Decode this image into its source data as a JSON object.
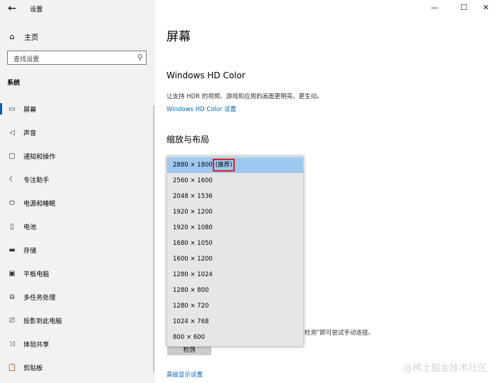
{
  "window": {
    "title": "设置",
    "back_glyph": "←",
    "controls": {
      "minimize": "—",
      "maximize": "☐",
      "close": "✕"
    }
  },
  "sidebar": {
    "home": {
      "icon": "home-icon",
      "label": "主页"
    },
    "search": {
      "placeholder": "查找设置"
    },
    "section": "系统",
    "items": [
      {
        "label": "屏幕",
        "icon": "display-icon",
        "active": true
      },
      {
        "label": "声音",
        "icon": "speaker-icon"
      },
      {
        "label": "通知和操作",
        "icon": "notification-icon"
      },
      {
        "label": "专注助手",
        "icon": "moon-icon"
      },
      {
        "label": "电源和睡眠",
        "icon": "power-icon"
      },
      {
        "label": "电池",
        "icon": "battery-icon"
      },
      {
        "label": "存储",
        "icon": "storage-icon"
      },
      {
        "label": "平板电脑",
        "icon": "tablet-icon"
      },
      {
        "label": "多任务处理",
        "icon": "multitask-icon"
      },
      {
        "label": "投影到此电脑",
        "icon": "project-icon"
      },
      {
        "label": "体验共享",
        "icon": "share-icon"
      },
      {
        "label": "剪贴板",
        "icon": "clipboard-icon"
      }
    ]
  },
  "main": {
    "title": "屏幕",
    "hdr": {
      "heading": "Windows HD Color",
      "description": "让支持 HDR 的视频、游戏和应用的画面更明亮、更生动。",
      "link": "Windows HD Color 设置"
    },
    "scale": {
      "heading": "缩放与布局"
    },
    "detect": {
      "hint": "检测”即可尝试手动连接。",
      "button": "检测"
    },
    "advanced_link": "高级显示设置"
  },
  "resolution_dropdown": {
    "recommended_label": "(推荐)",
    "options": [
      "2880 × 1800",
      "2560 × 1600",
      "2048 × 1536",
      "1920 × 1200",
      "1920 × 1080",
      "1680 × 1050",
      "1600 × 1200",
      "1280 × 1024",
      "1280 × 800",
      "1280 × 720",
      "1024 × 768",
      "800 × 600"
    ],
    "selected_index": 0
  },
  "watermark": "@稀土掘金技术社区",
  "colors": {
    "accent": "#0063b1",
    "link": "#0067b8",
    "selected": "#9ec9f0",
    "highlight_box": "#e02020"
  }
}
